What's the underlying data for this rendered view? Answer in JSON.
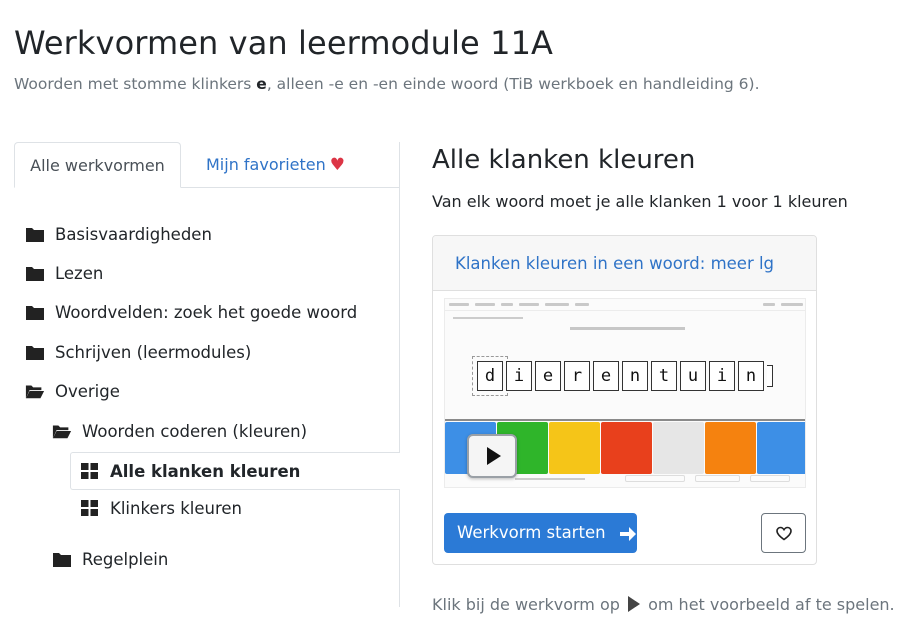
{
  "page": {
    "title": "Werkvormen van leermodule 11A",
    "subtitle_pre": "Woorden met stomme klinkers ",
    "subtitle_bold": "e",
    "subtitle_post": ", alleen -e en -en einde woord (TiB werkboek en handleiding 6)."
  },
  "tabs": {
    "all_label": "Alle werkvormen",
    "fav_label": "Mijn favorieten",
    "heart": "♥"
  },
  "tree": [
    {
      "label": "Basisvaardigheden",
      "icon": "folder-icon"
    },
    {
      "label": "Lezen",
      "icon": "folder-icon"
    },
    {
      "label": "Woordvelden: zoek het goede woord",
      "icon": "folder-icon"
    },
    {
      "label": "Schrijven (leermodules)",
      "icon": "folder-icon"
    },
    {
      "label": "Overige",
      "icon": "folder-open-icon"
    },
    {
      "label": "Woorden coderen (kleuren)",
      "icon": "folder-open-icon"
    },
    {
      "label": "Alle klanken kleuren",
      "icon": "grid-icon",
      "selected": true
    },
    {
      "label": "Klinkers kleuren",
      "icon": "grid-icon"
    },
    {
      "label": "Regelplein",
      "icon": "folder-icon"
    }
  ],
  "detail": {
    "title": "Alle klanken kleuren",
    "description": "Van elk woord moet je alle klanken 1 voor 1 kleuren",
    "card_title": "Klanken kleuren in een woord: meer lg",
    "preview_letters": [
      "d",
      "i",
      "e",
      "r",
      "e",
      "n",
      "t",
      "u",
      "i",
      "n"
    ],
    "swatch_colors": [
      "#3d8fe6",
      "#2fb52a",
      "#f5c518",
      "#e8401c",
      "#e6e6e6",
      "#f5820f",
      "#3d8fe6"
    ],
    "start_label": "Werkvorm starten",
    "footer_pre": "Klik bij de werkvorm op",
    "footer_post": "om het voorbeeld af te spelen."
  },
  "colors": {
    "link": "#2f73c7",
    "primary_button": "#2b7ad6",
    "heart": "#dc3545"
  }
}
